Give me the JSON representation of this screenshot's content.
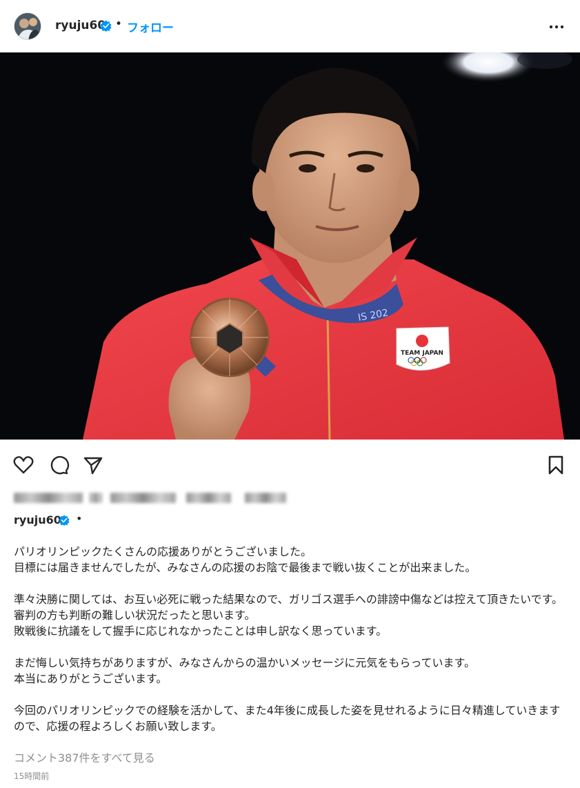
{
  "header": {
    "username": "ryuju60",
    "separator": "•",
    "follow_label": "フォロー"
  },
  "post": {
    "image_alt": "Judo athlete in Team Japan jacket holding a bronze medal",
    "jacket_badge": "TEAM JAPAN",
    "ribbon_text": "IS 202"
  },
  "actions": {
    "like_icon": "heart-icon",
    "comment_icon": "comment-icon",
    "share_icon": "paper-plane-icon",
    "save_icon": "bookmark-icon"
  },
  "caption": {
    "username": "ryuju60",
    "separator": "•",
    "lines": [
      "パリオリンピックたくさんの応援ありがとうございました。",
      "目標には届きませんでしたが、みなさんの応援のお陰で最後まで戦い抜くことが出来ました。",
      "",
      "準々決勝に関しては、お互い必死に戦った結果なので、ガリゴス選手への誹謗中傷などは控えて頂きたいです。",
      "審判の方も判断の難しい状況だったと思います。",
      "敗戦後に抗議をして握手に応じれなかったことは申し訳なく思っています。",
      "",
      "まだ悔しい気持ちがありますが、みなさんからの温かいメッセージに元気をもらっています。",
      "本当にありがとうございます。",
      "",
      "今回のパリオリンピックでの経験を活かして、また4年後に成長した姿を見せれるように日々精進していきますので、応援の程よろしくお願い致します。"
    ]
  },
  "comments_link": "コメント387件をすべて見る",
  "timestamp": "15時間前",
  "colors": {
    "accent": "#0095f6",
    "verified": "#0095f6",
    "text": "#262626",
    "muted": "#8e8e8e",
    "jacket": "#e8333b"
  }
}
